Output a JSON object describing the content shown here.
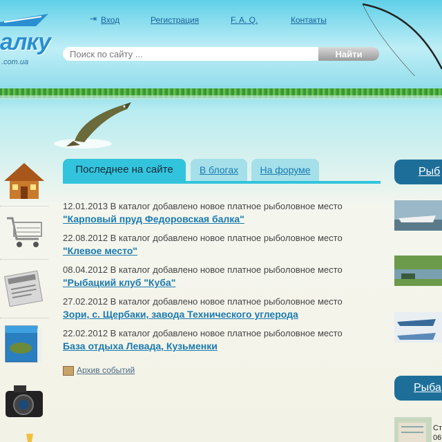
{
  "logo": {
    "text": "алку",
    "sub": ".com.ua"
  },
  "nav": {
    "login": "Вход",
    "register": "Регистрация",
    "faq": "F. A. Q.",
    "contacts": "Контакты"
  },
  "search": {
    "placeholder": "Поиск по сайту ...",
    "button": "Найти"
  },
  "tabs": [
    {
      "label": "Последнее на сайте"
    },
    {
      "label": "В блогах"
    },
    {
      "label": "На форуме"
    }
  ],
  "news": [
    {
      "date_text": "12.01.2013 В каталог добавлено новое платное рыболовное место",
      "link": "\"Карповый пруд Федоровская балка\""
    },
    {
      "date_text": "22.08.2012 В каталог добавлено новое платное рыболовное место",
      "link": "\"Клевое место\""
    },
    {
      "date_text": "08.04.2012 В каталог добавлено новое платное рыболовное место",
      "link": "\"Рыбацкий клуб \"Куба\""
    },
    {
      "date_text": "27.02.2012 В каталог добавлено новое платное рыболовное место",
      "link": "Зори, с. Щербаки, завода Технического углерода"
    },
    {
      "date_text": "22.02.2012 В каталог добавлено новое платное рыболовное место",
      "link": "База отдыха Левада, Кузьменки"
    }
  ],
  "archive": "Архив событий",
  "right": {
    "head1": "Рыб",
    "head2": "Рыба",
    "text1": "Ст",
    "text2": "06"
  },
  "colors": {
    "accent": "#32c4dc",
    "link": "#1a7ab0",
    "header_tab": "#1d6f9a"
  }
}
